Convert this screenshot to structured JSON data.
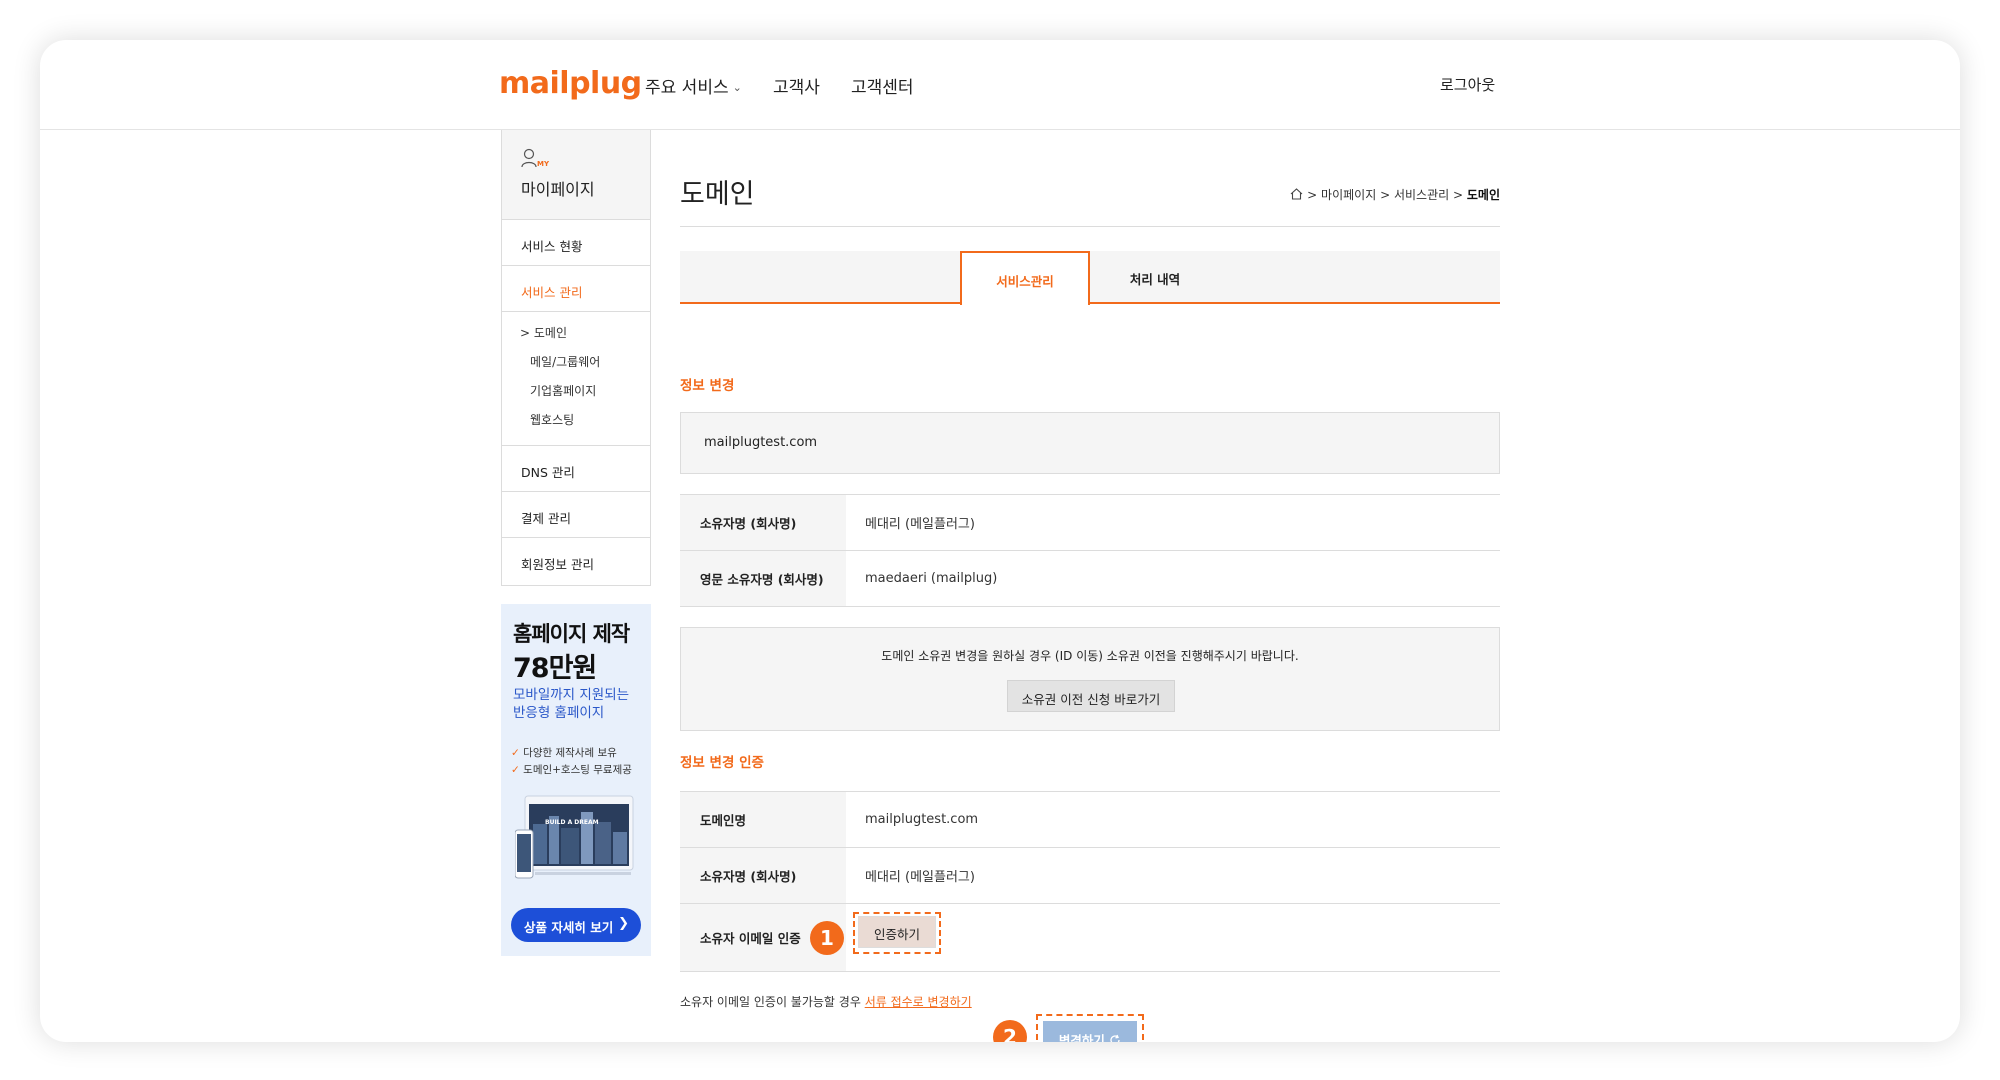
{
  "header": {
    "logo": "mailplug",
    "nav": {
      "services": "주요 서비스",
      "clients": "고객사",
      "support": "고객센터"
    },
    "logout": "로그아웃"
  },
  "sidebar": {
    "my_badge": "MY",
    "title": "마이페이지",
    "items": [
      {
        "label": "서비스 현황"
      },
      {
        "label": "서비스 관리"
      }
    ],
    "sub_items": [
      {
        "label": "> 도메인"
      },
      {
        "label": "메일/그룹웨어"
      },
      {
        "label": "기업홈페이지"
      },
      {
        "label": "웹호스팅"
      }
    ],
    "bottom_items": [
      {
        "label": "DNS 관리"
      },
      {
        "label": "결제 관리"
      },
      {
        "label": "회원정보 관리"
      }
    ]
  },
  "ad": {
    "line1": "홈페이지 제작",
    "line2": "78만원",
    "line3a": "모바일까지 지원되는",
    "line3b": "반응형 홈페이지",
    "bullet1": "다양한 제작사례 보유",
    "bullet2": "도메인+호스팅 무료제공",
    "image_text": "BUILD A DREAM",
    "button": "상품 자세히 보기"
  },
  "main": {
    "title": "도메인",
    "breadcrumb": {
      "sep": ">",
      "items": [
        "마이페이지",
        "서비스관리",
        "도메인"
      ]
    },
    "tabs": {
      "service": "서비스관리",
      "history": "처리 내역"
    },
    "section1_title": "정보 변경",
    "domain": "mailplugtest.com",
    "owner_table": [
      {
        "label": "소유자명 (회사명)",
        "value": "메대리 (메일플러그)"
      },
      {
        "label": "영문 소유자명 (회사명)",
        "value": "maedaeri (mailplug)"
      }
    ],
    "notice_text": "도메인 소유권 변경을 원하실 경우 (ID 이동) 소유권 이전을 진행해주시기 바랍니다.",
    "notice_button": "소유권 이전 신청 바로가기",
    "section2_title": "정보 변경 인증",
    "verify_table": [
      {
        "label": "도메인명",
        "value": "mailplugtest.com"
      },
      {
        "label": "소유자명 (회사명)",
        "value": "메대리 (메일플러그)"
      },
      {
        "label": "소유자 이메일 인증"
      }
    ],
    "verify_button": "인증하기",
    "step1": "1",
    "step2": "2",
    "footnote_prefix": "소유자 이메일 인증이 불가능할 경우 ",
    "footnote_link": "서류 접수로 변경하기",
    "change_button": "변경하기"
  },
  "colors": {
    "accent": "#f26a1b",
    "banner_blue": "#1d4fd8",
    "disabled_button": "#9bb9dd"
  }
}
